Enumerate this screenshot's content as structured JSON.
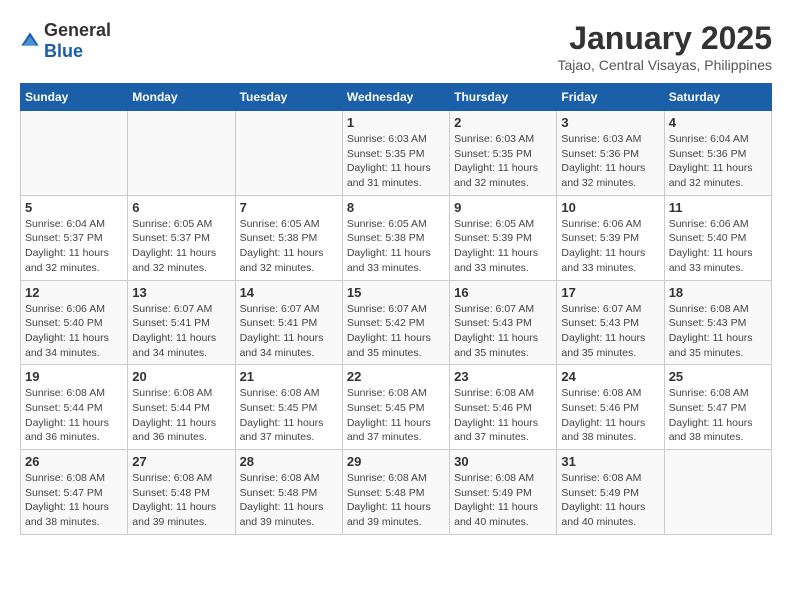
{
  "header": {
    "logo_general": "General",
    "logo_blue": "Blue",
    "main_title": "January 2025",
    "subtitle": "Tajao, Central Visayas, Philippines"
  },
  "calendar": {
    "days_of_week": [
      "Sunday",
      "Monday",
      "Tuesday",
      "Wednesday",
      "Thursday",
      "Friday",
      "Saturday"
    ],
    "weeks": [
      [
        {
          "day": "",
          "info": ""
        },
        {
          "day": "",
          "info": ""
        },
        {
          "day": "",
          "info": ""
        },
        {
          "day": "1",
          "info": "Sunrise: 6:03 AM\nSunset: 5:35 PM\nDaylight: 11 hours and 31 minutes."
        },
        {
          "day": "2",
          "info": "Sunrise: 6:03 AM\nSunset: 5:35 PM\nDaylight: 11 hours and 32 minutes."
        },
        {
          "day": "3",
          "info": "Sunrise: 6:03 AM\nSunset: 5:36 PM\nDaylight: 11 hours and 32 minutes."
        },
        {
          "day": "4",
          "info": "Sunrise: 6:04 AM\nSunset: 5:36 PM\nDaylight: 11 hours and 32 minutes."
        }
      ],
      [
        {
          "day": "5",
          "info": "Sunrise: 6:04 AM\nSunset: 5:37 PM\nDaylight: 11 hours and 32 minutes."
        },
        {
          "day": "6",
          "info": "Sunrise: 6:05 AM\nSunset: 5:37 PM\nDaylight: 11 hours and 32 minutes."
        },
        {
          "day": "7",
          "info": "Sunrise: 6:05 AM\nSunset: 5:38 PM\nDaylight: 11 hours and 32 minutes."
        },
        {
          "day": "8",
          "info": "Sunrise: 6:05 AM\nSunset: 5:38 PM\nDaylight: 11 hours and 33 minutes."
        },
        {
          "day": "9",
          "info": "Sunrise: 6:05 AM\nSunset: 5:39 PM\nDaylight: 11 hours and 33 minutes."
        },
        {
          "day": "10",
          "info": "Sunrise: 6:06 AM\nSunset: 5:39 PM\nDaylight: 11 hours and 33 minutes."
        },
        {
          "day": "11",
          "info": "Sunrise: 6:06 AM\nSunset: 5:40 PM\nDaylight: 11 hours and 33 minutes."
        }
      ],
      [
        {
          "day": "12",
          "info": "Sunrise: 6:06 AM\nSunset: 5:40 PM\nDaylight: 11 hours and 34 minutes."
        },
        {
          "day": "13",
          "info": "Sunrise: 6:07 AM\nSunset: 5:41 PM\nDaylight: 11 hours and 34 minutes."
        },
        {
          "day": "14",
          "info": "Sunrise: 6:07 AM\nSunset: 5:41 PM\nDaylight: 11 hours and 34 minutes."
        },
        {
          "day": "15",
          "info": "Sunrise: 6:07 AM\nSunset: 5:42 PM\nDaylight: 11 hours and 35 minutes."
        },
        {
          "day": "16",
          "info": "Sunrise: 6:07 AM\nSunset: 5:43 PM\nDaylight: 11 hours and 35 minutes."
        },
        {
          "day": "17",
          "info": "Sunrise: 6:07 AM\nSunset: 5:43 PM\nDaylight: 11 hours and 35 minutes."
        },
        {
          "day": "18",
          "info": "Sunrise: 6:08 AM\nSunset: 5:43 PM\nDaylight: 11 hours and 35 minutes."
        }
      ],
      [
        {
          "day": "19",
          "info": "Sunrise: 6:08 AM\nSunset: 5:44 PM\nDaylight: 11 hours and 36 minutes."
        },
        {
          "day": "20",
          "info": "Sunrise: 6:08 AM\nSunset: 5:44 PM\nDaylight: 11 hours and 36 minutes."
        },
        {
          "day": "21",
          "info": "Sunrise: 6:08 AM\nSunset: 5:45 PM\nDaylight: 11 hours and 37 minutes."
        },
        {
          "day": "22",
          "info": "Sunrise: 6:08 AM\nSunset: 5:45 PM\nDaylight: 11 hours and 37 minutes."
        },
        {
          "day": "23",
          "info": "Sunrise: 6:08 AM\nSunset: 5:46 PM\nDaylight: 11 hours and 37 minutes."
        },
        {
          "day": "24",
          "info": "Sunrise: 6:08 AM\nSunset: 5:46 PM\nDaylight: 11 hours and 38 minutes."
        },
        {
          "day": "25",
          "info": "Sunrise: 6:08 AM\nSunset: 5:47 PM\nDaylight: 11 hours and 38 minutes."
        }
      ],
      [
        {
          "day": "26",
          "info": "Sunrise: 6:08 AM\nSunset: 5:47 PM\nDaylight: 11 hours and 38 minutes."
        },
        {
          "day": "27",
          "info": "Sunrise: 6:08 AM\nSunset: 5:48 PM\nDaylight: 11 hours and 39 minutes."
        },
        {
          "day": "28",
          "info": "Sunrise: 6:08 AM\nSunset: 5:48 PM\nDaylight: 11 hours and 39 minutes."
        },
        {
          "day": "29",
          "info": "Sunrise: 6:08 AM\nSunset: 5:48 PM\nDaylight: 11 hours and 39 minutes."
        },
        {
          "day": "30",
          "info": "Sunrise: 6:08 AM\nSunset: 5:49 PM\nDaylight: 11 hours and 40 minutes."
        },
        {
          "day": "31",
          "info": "Sunrise: 6:08 AM\nSunset: 5:49 PM\nDaylight: 11 hours and 40 minutes."
        },
        {
          "day": "",
          "info": ""
        }
      ]
    ]
  }
}
